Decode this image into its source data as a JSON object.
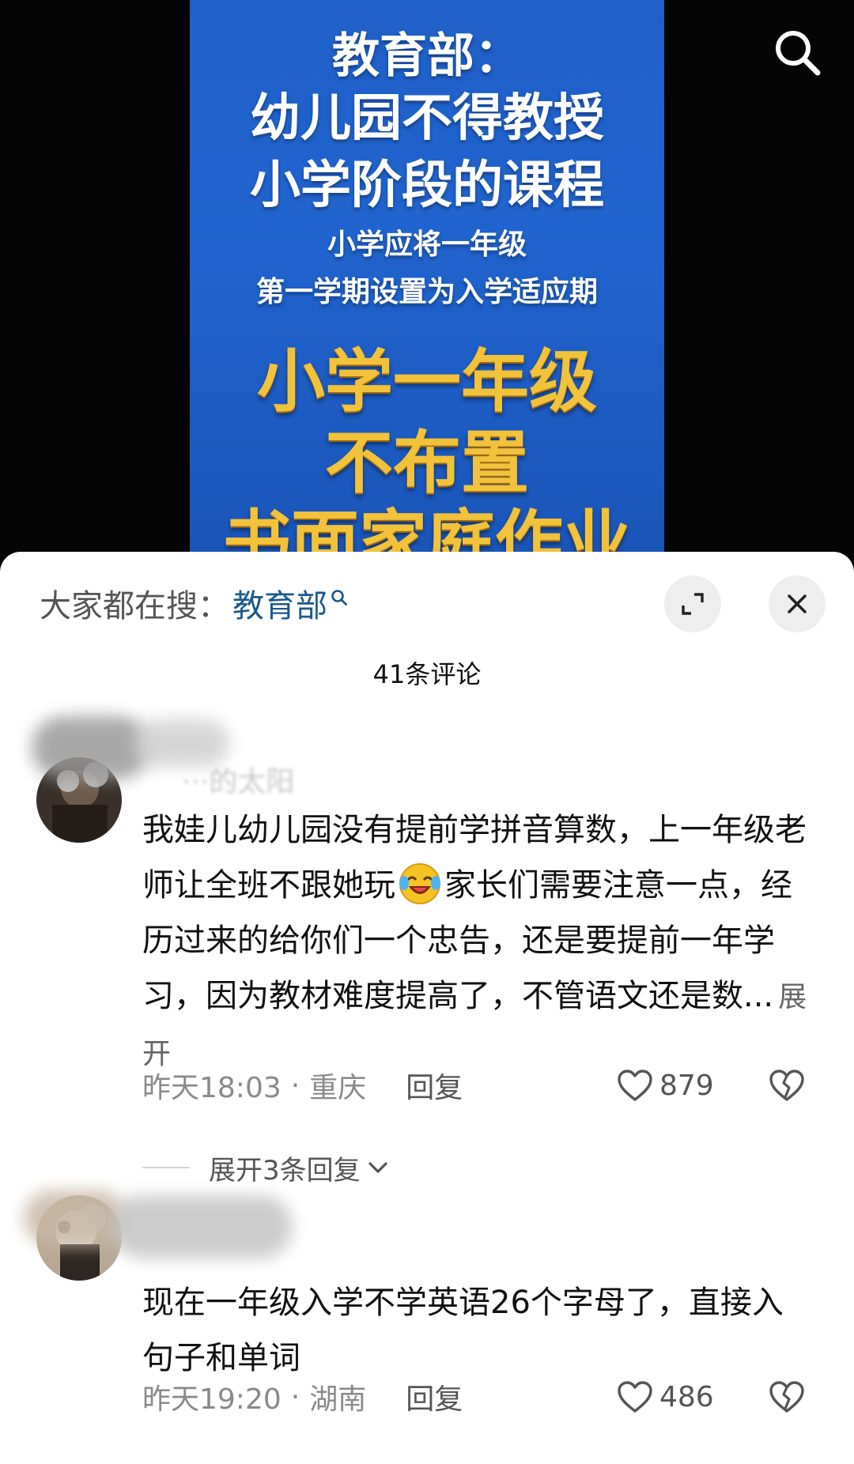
{
  "video": {
    "poster_lines": [
      "教育部：",
      "幼儿园不得教授",
      "小学阶段的课程",
      "小学应将一年级",
      "第一学期设置为入学适应期",
      "小学一年级",
      "不布置",
      "书面家庭作业"
    ],
    "search_icon": "search-icon",
    "poster_color": "#1f5fc8",
    "highlight_color": "#f2c23a"
  },
  "sheet": {
    "hot_search_label": "大家都在搜：",
    "hot_search_term": "教育部",
    "hot_search_term_color": "#1a5a8c",
    "expand_icon": "expand-icon",
    "close_icon": "close-icon",
    "comment_count": "41条评论"
  },
  "comments": [
    {
      "username": "···的太阳",
      "text_part1": "我娃儿幼儿园没有提前学拼音算数，上一年级老师让全班不跟她玩",
      "emoji": "laughing-crying-emoji",
      "text_part2": "家长们需要注意一点，经历过来的给你们一个忠告，还是要提前一年学习，因为教材难度提高了，不管语文还是数...",
      "expand_label": "展开",
      "time": "昨天18:03",
      "location": "重庆",
      "separator": "·",
      "reply_label": "回复",
      "likes": "879",
      "more_replies": "展开3条回复"
    },
    {
      "text": "现在一年级入学不学英语26个字母了，直接入句子和单词",
      "time": "昨天19:20",
      "location": "湖南",
      "separator": "·",
      "reply_label": "回复",
      "likes": "486"
    }
  ]
}
